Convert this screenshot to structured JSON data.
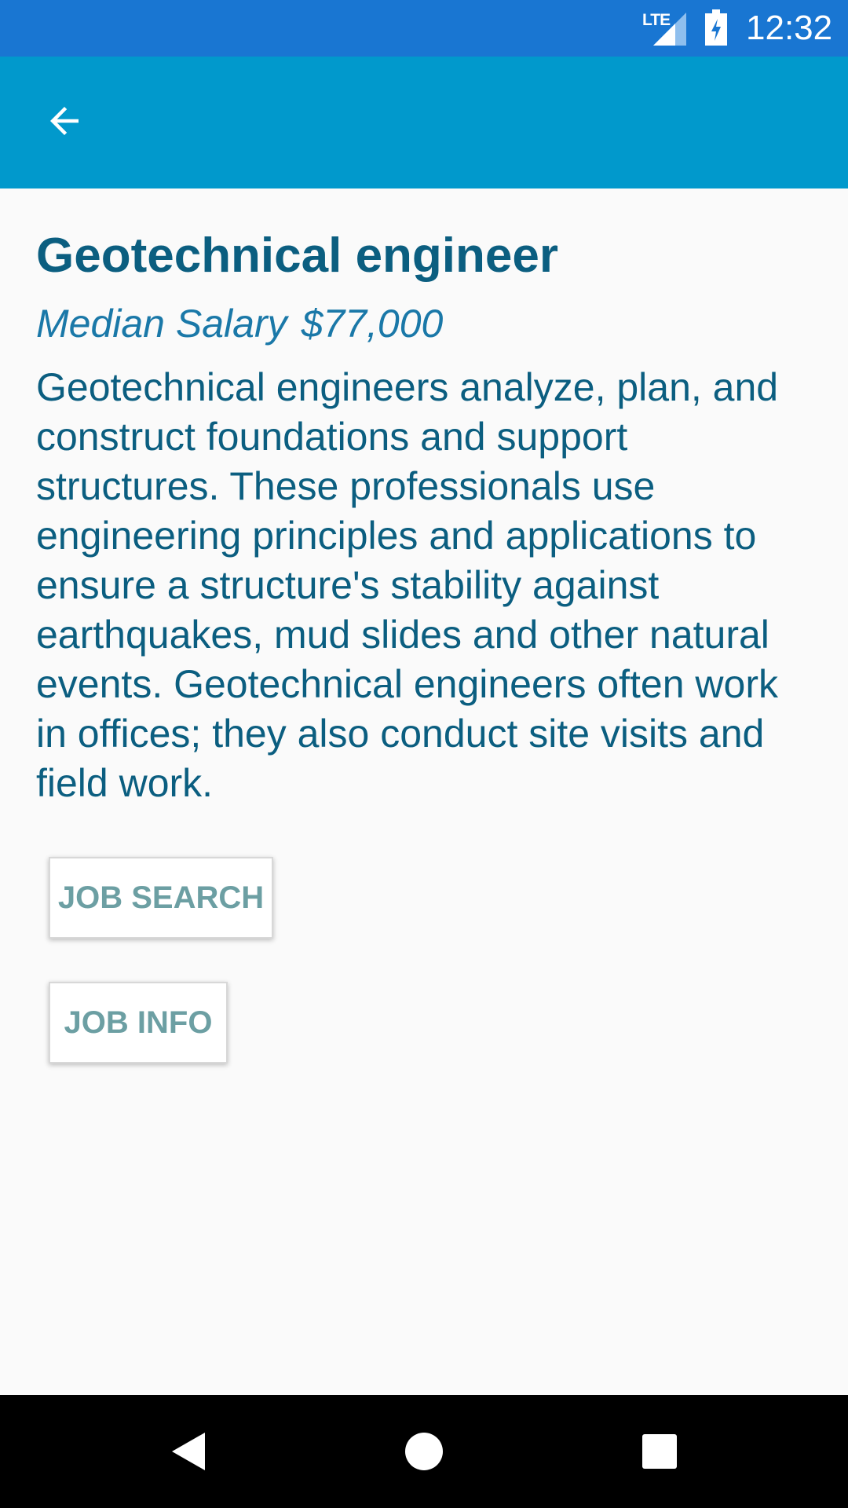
{
  "status_bar": {
    "network": "LTE",
    "time": "12:32",
    "icons": [
      "lte-signal-icon",
      "battery-charging-icon"
    ]
  },
  "app_bar": {
    "back_icon": "arrow-back-icon"
  },
  "job": {
    "title": "Geotechnical engineer",
    "salary_label": "Median Salary",
    "salary_value": "$77,000",
    "description": "Geotechnical engineers analyze, plan, and construct foundations and support structures. These professionals use engineering principles and applications to ensure a structure's stability against earthquakes, mud slides and other natural events. Geotechnical engineers often work in offices; they also conduct site visits and field work."
  },
  "buttons": {
    "job_search": "JOB SEARCH",
    "job_info": "JOB INFO"
  },
  "nav_bar": {
    "icons": [
      "nav-back-icon",
      "nav-home-icon",
      "nav-recents-icon"
    ]
  },
  "colors": {
    "status_bar": "#1976d2",
    "app_bar": "#0199cc",
    "title_text": "#0b5e80",
    "salary_text": "#1a78a8",
    "button_text": "#6c9fa3",
    "background": "#fafafa"
  }
}
